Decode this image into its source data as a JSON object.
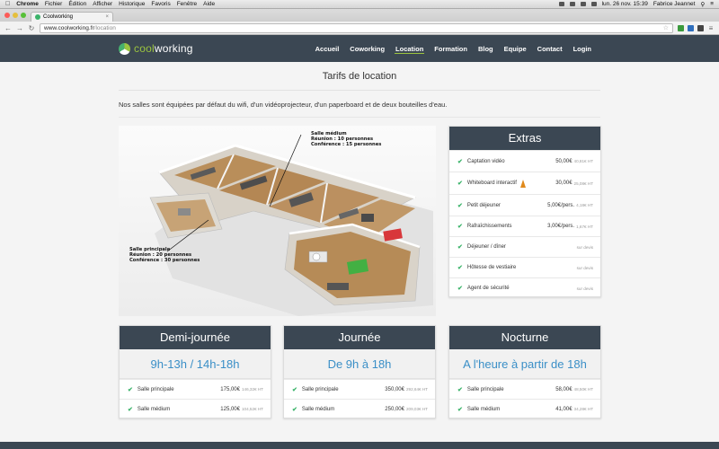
{
  "mac_menu": {
    "app": "Chrome",
    "items": [
      "Fichier",
      "Édition",
      "Afficher",
      "Historique",
      "Favoris",
      "Fenêtre",
      "Aide"
    ],
    "clock": "lun. 26 nov.  15:39",
    "user": "Fabrice Jeannet"
  },
  "browser": {
    "tab_title": "Coolworking",
    "url_host": "www.coolworking.fr",
    "url_path": "/location"
  },
  "site": {
    "logo_cool": "cool",
    "logo_working": "working",
    "nav": [
      {
        "label": "Accueil"
      },
      {
        "label": "Coworking"
      },
      {
        "label": "Location"
      },
      {
        "label": "Formation"
      },
      {
        "label": "Blog"
      },
      {
        "label": "Equipe"
      },
      {
        "label": "Contact"
      },
      {
        "label": "Login"
      }
    ],
    "active_nav": "Location"
  },
  "page": {
    "title": "Tarifs de location",
    "intro": "Nos salles sont équipées par défaut du wifi, d'un vidéoprojecteur, d'un paperboard et de deux bouteilles d'eau."
  },
  "floorplan": {
    "medium_label": [
      "Salle médium",
      "Réunion : 10 personnes",
      "Conférence : 15 personnes"
    ],
    "main_label": [
      "Salle principale",
      "Réunion : 20 personnes",
      "Conférence : 30 personnes"
    ]
  },
  "extras": {
    "title": "Extras",
    "items": [
      {
        "name": "Captation vidéo",
        "price": "50,00€",
        "ht": "40,81€ HT"
      },
      {
        "name": "Whiteboard interactif",
        "price": "30,00€",
        "ht": "25,08€ HT",
        "icon": "traffic-cone-icon"
      },
      {
        "name": "Petit déjeuner",
        "price": "5,00€/pers.",
        "ht": "4,18€ HT"
      },
      {
        "name": "Rafraîchissements",
        "price": "3,00€/pers.",
        "ht": "1,67€ HT"
      },
      {
        "name": "Déjeuner / dîner",
        "devis": "sur devis"
      },
      {
        "name": "Hôtesse de vestiaire",
        "devis": "sur devis"
      },
      {
        "name": "Agent de sécurité",
        "devis": "sur devis"
      }
    ]
  },
  "cards": [
    {
      "title": "Demi-journée",
      "hours": "9h-13h / 14h-18h",
      "rows": [
        {
          "name": "Salle principale",
          "price": "175,00€",
          "ht": "146,32€ HT"
        },
        {
          "name": "Salle médium",
          "price": "125,00€",
          "ht": "104,52€ HT"
        }
      ]
    },
    {
      "title": "Journée",
      "hours": "De 9h à 18h",
      "rows": [
        {
          "name": "Salle principale",
          "price": "350,00€",
          "ht": "292,64€ HT"
        },
        {
          "name": "Salle médium",
          "price": "250,00€",
          "ht": "209,03€ HT"
        }
      ]
    },
    {
      "title": "Nocturne",
      "hours": "A l'heure à partir de 18h",
      "rows": [
        {
          "name": "Salle principale",
          "price": "58,00€",
          "ht": "48,50€ HT"
        },
        {
          "name": "Salle médium",
          "price": "41,00€",
          "ht": "34,28€ HT"
        }
      ]
    }
  ],
  "colors": {
    "header_bg": "#3b4753",
    "accent_green": "#9bc43f",
    "check_green": "#3bb36a",
    "hours_blue": "#3a8fc7"
  }
}
